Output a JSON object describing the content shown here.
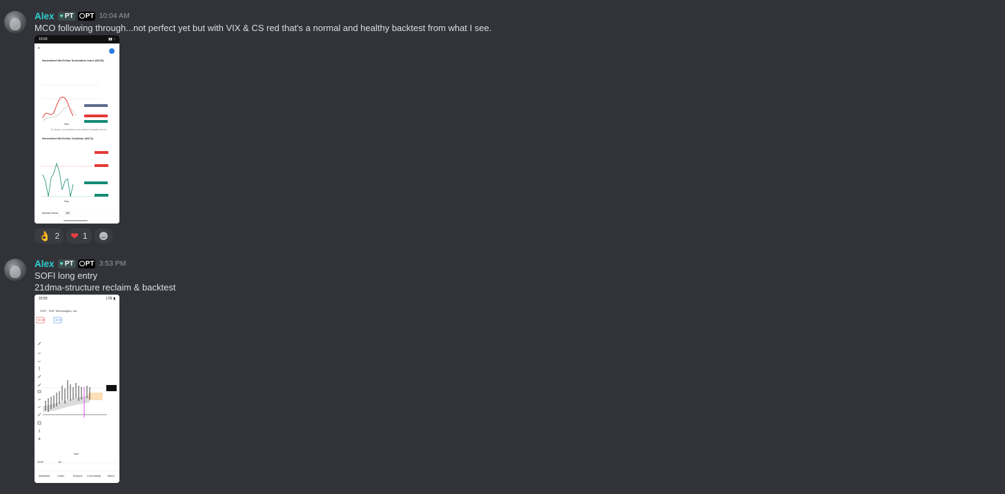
{
  "messages": [
    {
      "username": "Alex",
      "tag1": "PT",
      "tag2": "PT",
      "time": "10:04 AM",
      "lines": [
        "MCO following through...not perfect yet but with VIX & CS red that's a normal and healthy backtest from what I see."
      ],
      "screenshot": {
        "status_time": "10:03",
        "chart1_title": "Normalized McClellan Summation Index (MCSI)",
        "chart1_note": "B Illustr. normalized cumulative breadth trend",
        "chart2_title": "Normalized McClellan Oscillator (MCO)",
        "axis_label": "Nov",
        "bottom_label": "Market News",
        "bottom_badge": "69"
      },
      "reactions": [
        {
          "emoji": "ok-hand",
          "count": "2"
        },
        {
          "emoji": "red-heart",
          "count": "1"
        }
      ]
    },
    {
      "username": "Alex",
      "tag1": "PT",
      "tag2": "PT",
      "time": "3:53 PM",
      "lines": [
        "SOFI long entry",
        "21dma-structure reclaim & backtest"
      ],
      "screenshot": {
        "status_time": "15:53",
        "ticker_title": "SOFI · SoFi Technologies, Inc.",
        "price_left": "30.90",
        "price_right": "30.91",
        "symbol": "SOFI",
        "interval": "1D",
        "axis_label": "Nov",
        "nav": [
          "Watchlist",
          "Chart",
          "Explore",
          "Community",
          "Menu"
        ]
      }
    }
  ],
  "colors": {
    "background": "#313338",
    "username": "#2fd1d1",
    "text": "#dbdee1",
    "time": "#949ba4",
    "reaction_bg": "#3a3c42"
  }
}
